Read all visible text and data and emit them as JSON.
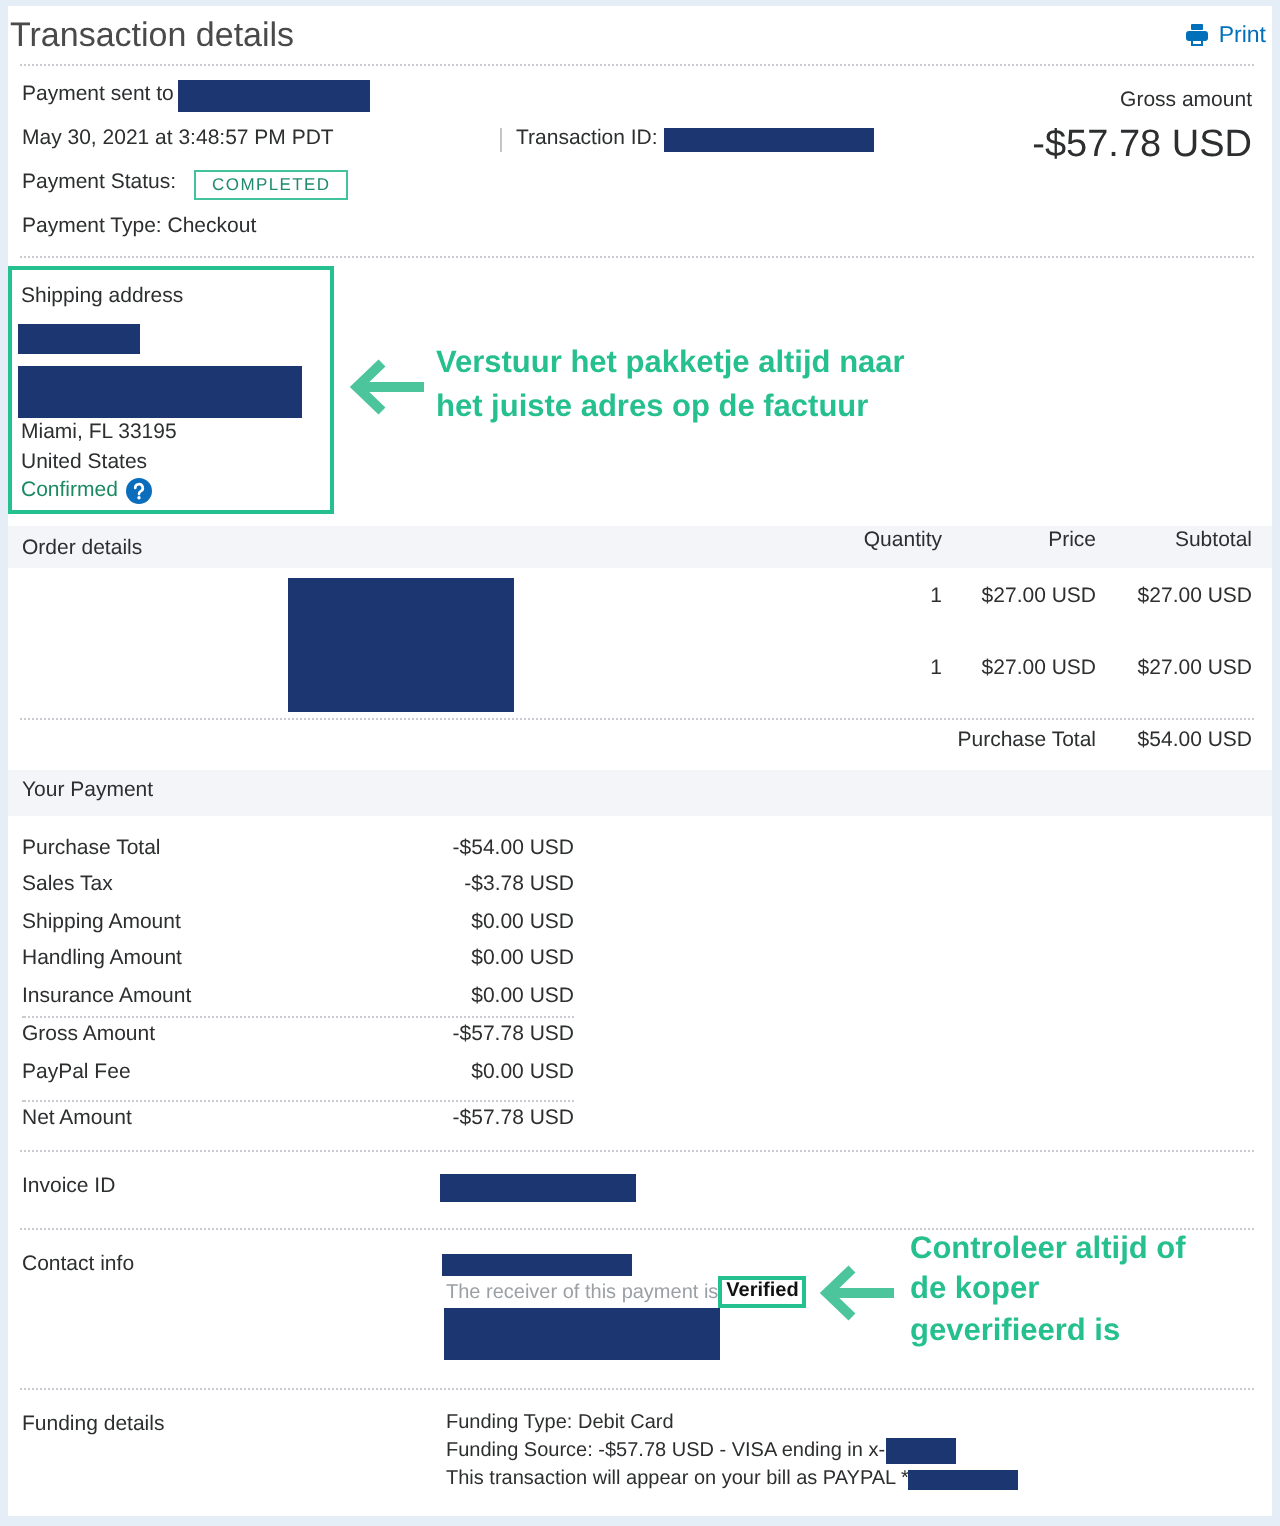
{
  "header": {
    "title": "Transaction details",
    "print_label": "Print"
  },
  "summary": {
    "sent_to_label": "Payment sent to",
    "payee_redacted": true,
    "date": "May 30, 2021 at 3:48:57 PM PDT",
    "transaction_id_label": "Transaction ID:",
    "transaction_id_redacted": true,
    "gross_label": "Gross amount",
    "gross_amount": "-$57.78 USD",
    "status_label": "Payment Status:",
    "status": "COMPLETED",
    "payment_type": "Payment Type: Checkout"
  },
  "shipping": {
    "title": "Shipping address",
    "name_redacted": true,
    "street_redacted": true,
    "city": "Miami, FL 33195",
    "country": "United States",
    "confirmed_label": "Confirmed",
    "highlighted": true,
    "annotation": {
      "lines": [
        "Verstuur het pakketje altijd naar",
        "het juiste adres op de factuur"
      ]
    }
  },
  "order": {
    "columns": [
      "Order details",
      "Quantity",
      "Price",
      "Subtotal"
    ],
    "item_redacted": true,
    "rows": [
      {
        "quantity": "1",
        "price": "$27.00 USD",
        "subtotal": "$27.00 USD"
      },
      {
        "quantity": "1",
        "price": "$27.00 USD",
        "subtotal": "$27.00 USD"
      }
    ],
    "total_label": "Purchase Total",
    "total": "$54.00 USD"
  },
  "payment": {
    "title": "Your Payment",
    "groups": [
      {
        "rows": [
          {
            "label": "Purchase Total",
            "amount": "-$54.00 USD"
          },
          {
            "label": "Sales Tax",
            "amount": "-$3.78 USD"
          },
          {
            "label": "Shipping Amount",
            "amount": "$0.00 USD"
          },
          {
            "label": "Handling Amount",
            "amount": "$0.00 USD"
          },
          {
            "label": "Insurance Amount",
            "amount": "$0.00 USD"
          }
        ]
      },
      {
        "rows": [
          {
            "label": "Gross Amount",
            "amount": "-$57.78 USD"
          },
          {
            "label": "PayPal Fee",
            "amount": "$0.00 USD"
          }
        ]
      },
      {
        "rows": [
          {
            "label": "Net Amount",
            "amount": "-$57.78 USD"
          }
        ]
      }
    ]
  },
  "invoice": {
    "label": "Invoice ID",
    "redacted": true
  },
  "contact": {
    "label": "Contact info",
    "email_redacted": true,
    "verification_text": "The receiver of this payment is",
    "verification_status": "Verified",
    "highlighted": true,
    "details_redacted": true,
    "annotation": {
      "lines": [
        "Controleer altijd of",
        "de koper",
        "geverifieerd is"
      ]
    }
  },
  "funding": {
    "label": "Funding details",
    "lines": [
      {
        "text": "Funding Type: Debit Card",
        "redacted": false
      },
      {
        "text": "Funding Source: -$57.78 USD - VISA ending in x-",
        "redacted": true
      },
      {
        "text": "This transaction will appear on your bill as PAYPAL *",
        "redacted": true
      }
    ]
  }
}
